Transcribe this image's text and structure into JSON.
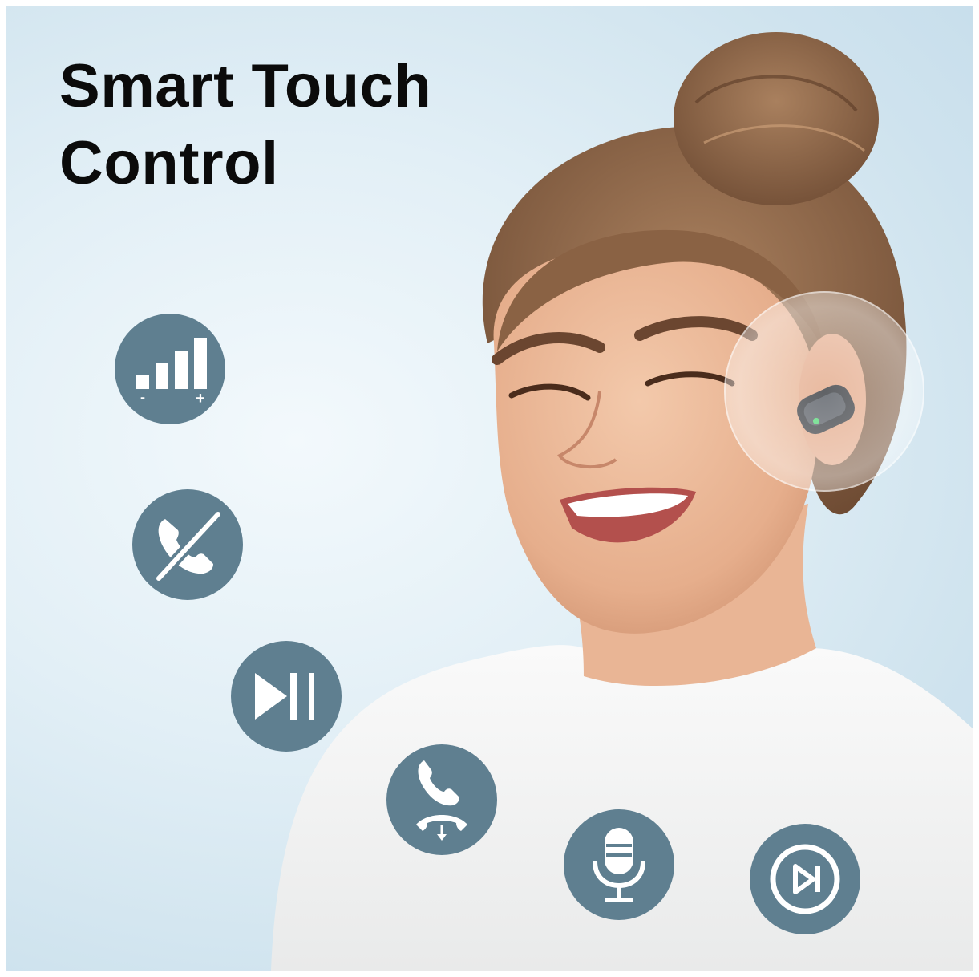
{
  "headline": {
    "line1": "Smart Touch",
    "line2": "Control"
  },
  "features": [
    {
      "icon": "volume-bars-icon",
      "minus": "-",
      "plus": "+"
    },
    {
      "icon": "reject-call-icon"
    },
    {
      "icon": "play-pause-icon"
    },
    {
      "icon": "answer-hangup-call-icon"
    },
    {
      "icon": "voice-assistant-mic-icon"
    },
    {
      "icon": "next-track-icon"
    }
  ],
  "colors": {
    "icon_circle": "#5f7f90",
    "icon_glyph": "#ffffff",
    "headline": "#0b0b0b",
    "background": "#dcecf4"
  }
}
